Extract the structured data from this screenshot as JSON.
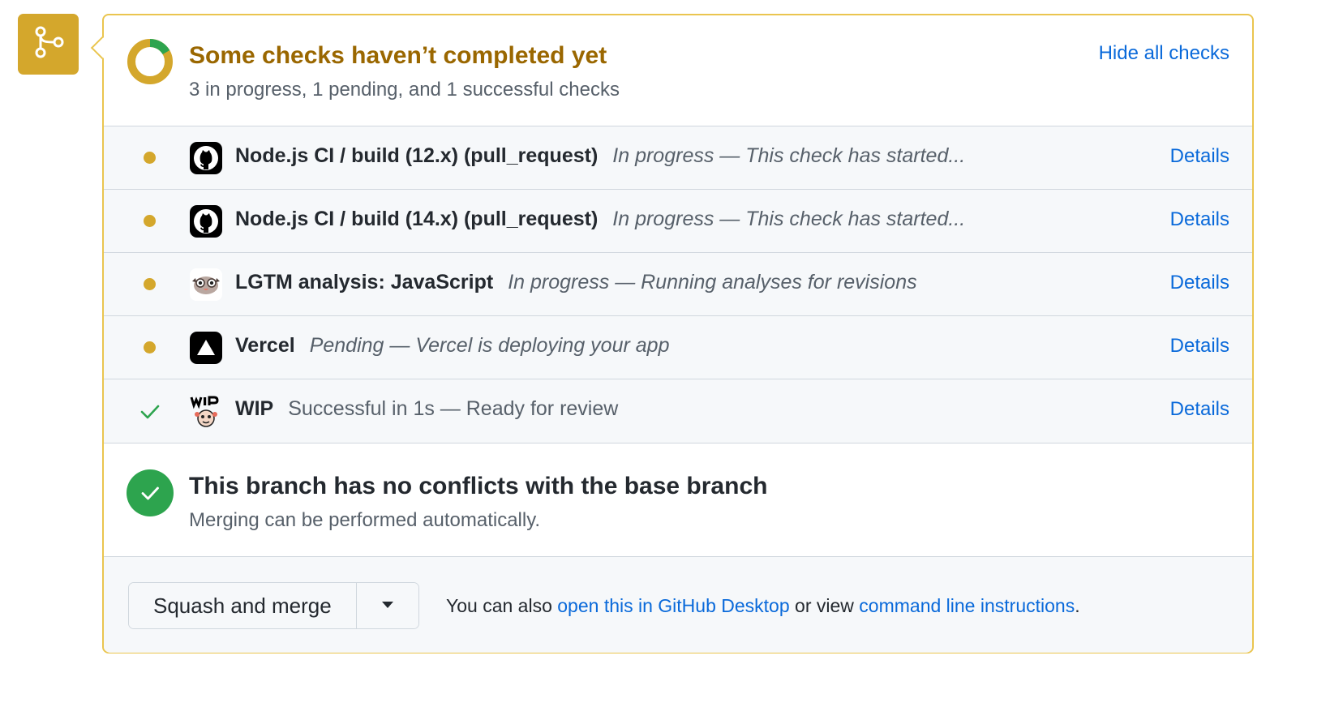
{
  "colors": {
    "pending": "#d4a72c",
    "pending_title": "#9a6700",
    "success": "#2da44e",
    "link": "#0969da"
  },
  "merge_badge": {
    "icon": "git-merge-icon"
  },
  "checks": {
    "status": "pending",
    "title": "Some checks haven’t completed yet",
    "subtitle": "3 in progress, 1 pending, and 1 successful checks",
    "hide_label": "Hide all checks",
    "donut_icon": "progress-ring-icon",
    "items": [
      {
        "status": "in_progress",
        "app_icon": "github-logo-icon",
        "name": "Node.js CI / build (12.x) (pull_request)",
        "description": "In progress — This check has started...",
        "details_label": "Details"
      },
      {
        "status": "in_progress",
        "app_icon": "github-logo-icon",
        "name": "Node.js CI / build (14.x) (pull_request)",
        "description": "In progress — This check has started...",
        "details_label": "Details"
      },
      {
        "status": "in_progress",
        "app_icon": "lgtm-owl-icon",
        "name": "LGTM analysis: JavaScript",
        "description": "In progress — Running analyses for revisions",
        "details_label": "Details"
      },
      {
        "status": "pending",
        "app_icon": "vercel-logo-icon",
        "name": "Vercel",
        "description": "Pending — Vercel is deploying your app",
        "details_label": "Details"
      },
      {
        "status": "success",
        "app_icon": "wip-bot-icon",
        "name": "WIP",
        "description": "Successful in 1s — Ready for review",
        "details_label": "Details"
      }
    ]
  },
  "conflicts": {
    "icon": "check-circle-icon",
    "title": "This branch has no conflicts with the base branch",
    "subtitle": "Merging can be performed automatically."
  },
  "merge": {
    "button_label": "Squash and merge",
    "dropdown_icon": "triangle-down-icon",
    "note_prefix": "You can also",
    "desktop_link": "open this in GitHub Desktop",
    "note_middle": "or view",
    "cli_link": "command line instructions",
    "note_suffix": "."
  }
}
